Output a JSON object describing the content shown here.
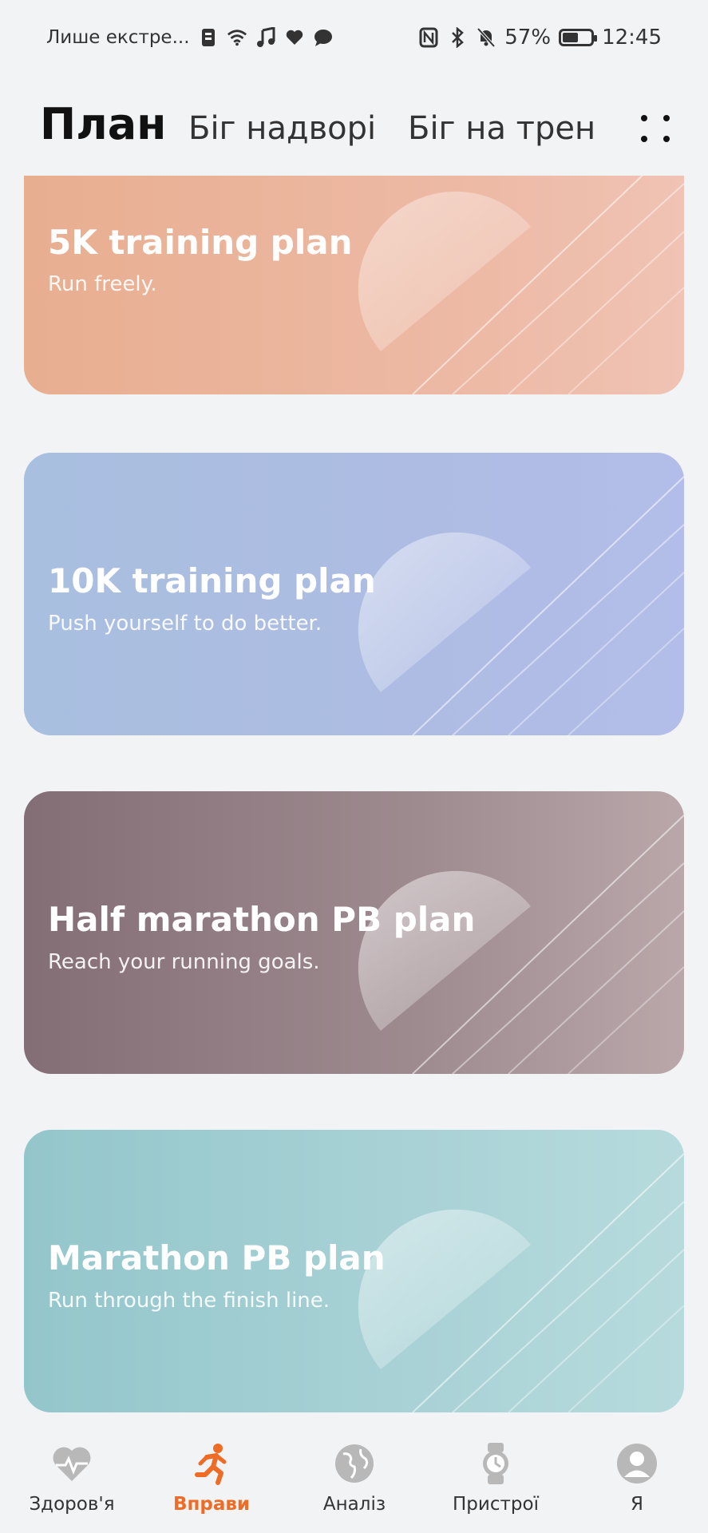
{
  "status_bar": {
    "notification_text": "Лише екстре...",
    "battery_percent": "57%",
    "battery_level": 0.57,
    "time": "12:45"
  },
  "header": {
    "active_tab": "План",
    "tabs": [
      "Біг надворі",
      "Біг на трен"
    ]
  },
  "cards": [
    {
      "title": "5K training plan",
      "subtitle": "Run freely."
    },
    {
      "title": "10K training plan",
      "subtitle": "Push yourself to do better."
    },
    {
      "title": "Half marathon PB plan",
      "subtitle": "Reach your running goals."
    },
    {
      "title": "Marathon PB plan",
      "subtitle": "Run through the finish line."
    }
  ],
  "bottom_nav": [
    {
      "label": "Здоров'я",
      "icon": "heart-pulse-icon"
    },
    {
      "label": "Вправи",
      "icon": "running-person-icon",
      "active": true
    },
    {
      "label": "Аналіз",
      "icon": "globe-icon"
    },
    {
      "label": "Пристрої",
      "icon": "watch-icon"
    },
    {
      "label": "Я",
      "icon": "user-avatar-icon"
    }
  ],
  "colors": {
    "accent": "#ee6c26",
    "card_5k": "#e8ae90",
    "card_10k": "#a8bfdf",
    "card_half": "#836e75",
    "card_marathon": "#93c6cb"
  }
}
